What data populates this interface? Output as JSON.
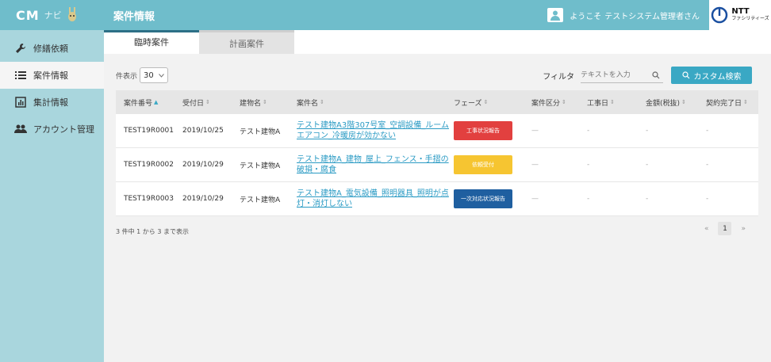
{
  "brand": {
    "cm": "CM",
    "navi": "ナビ"
  },
  "header": {
    "title": "案件情報",
    "welcome": "ようこそ",
    "username": "テストシステム管理者さん",
    "company_top": "NTT",
    "company_bottom": "ファシリティーズ"
  },
  "sidebar": {
    "items": [
      {
        "label": "修繕依頼",
        "icon": "wrench-icon"
      },
      {
        "label": "案件情報",
        "icon": "list-icon"
      },
      {
        "label": "集計情報",
        "icon": "chart-icon"
      },
      {
        "label": "アカウント管理",
        "icon": "users-icon"
      }
    ]
  },
  "tabs": [
    {
      "label": "臨時案件"
    },
    {
      "label": "計画案件"
    }
  ],
  "toolbar": {
    "perpage_label": "件表示",
    "perpage_value": "30",
    "filter_label": "フィルタ",
    "filter_placeholder": "テキストを入力",
    "custom_search": "カスタム検索"
  },
  "table": {
    "headers": [
      "案件番号",
      "受付日",
      "建物名",
      "案件名",
      "フェーズ",
      "案件区分",
      "工事日",
      "金額(税抜)",
      "契約完了日"
    ],
    "rows": [
      {
        "id": "TEST19R0001",
        "date": "2019/10/25",
        "building": "テスト建物A",
        "name": "テスト建物A3階307号室_空調設備_ルームエアコン_冷暖房が効かない",
        "phase": "工事状況報告",
        "phase_color": "#e2403f",
        "category": "—",
        "work_date": "-",
        "amount": "-",
        "complete": "-"
      },
      {
        "id": "TEST19R0002",
        "date": "2019/10/29",
        "building": "テスト建物A",
        "name": "テスト建物A_建物_屋上_フェンス・手摺の破損・腐食",
        "phase": "依頼受付",
        "phase_color": "#f6c531",
        "category": "—",
        "work_date": "-",
        "amount": "-",
        "complete": "-"
      },
      {
        "id": "TEST19R0003",
        "date": "2019/10/29",
        "building": "テスト建物A",
        "name": "テスト建物A_電気設備_照明器具_照明が点灯・消灯しない",
        "phase": "一次対応状況報告",
        "phase_color": "#1f5fa0",
        "category": "—",
        "work_date": "-",
        "amount": "-",
        "complete": "-"
      }
    ]
  },
  "footer": {
    "info": "3 件中 1 から 3 まで表示",
    "prev": "«",
    "page": "1",
    "next": "»"
  }
}
